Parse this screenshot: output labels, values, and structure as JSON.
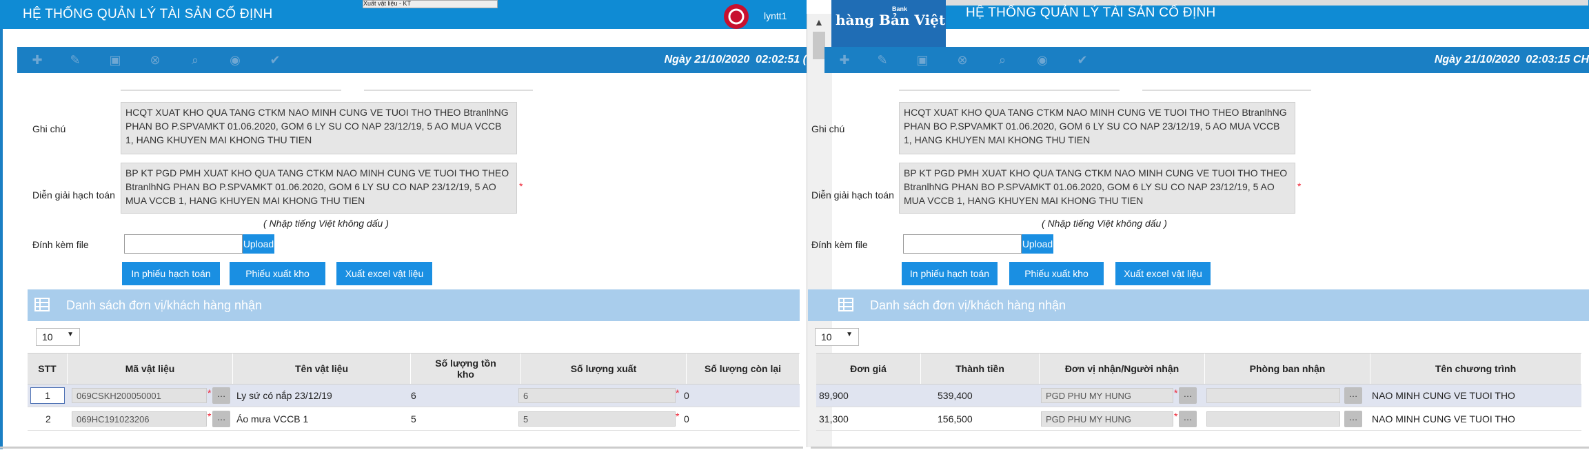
{
  "left": {
    "app_title": "HỆ THỐNG QUẢN LÝ TÀI SẢN CỐ ĐỊNH",
    "user": "lyntt1",
    "date_label": "Ngày",
    "date": "21/10/2020",
    "time": "02:02:51 (",
    "browser_tab": "Xuất vật liệu - KT"
  },
  "right": {
    "app_title": "HỆ THỐNG QUẢN LÝ TÀI SẢN CỐ ĐỊNH",
    "bank_logo_text": "hàng Bản Việt",
    "bank_logo_small": "Bank",
    "date_label": "Ngày",
    "date": "21/10/2020",
    "time": "02:03:15 CH"
  },
  "form": {
    "note_label": "Ghi chú",
    "note_value": "HCQT XUAT KHO QUA TANG CTKM NAO MINH CUNG VE TUOI THO THEO BtranlhNG PHAN BO P.SPVAMKT 01.06.2020, GOM 6 LY SU CO NAP 23/12/19, 5 AO MUA VCCB 1, HANG KHUYEN MAI KHONG THU TIEN",
    "explain_label": "Diễn giải hạch toán",
    "explain_value": "BP KT PGD PMH XUAT KHO QUA TANG CTKM NAO MINH CUNG VE TUOI THO THEO BtranlhNG PHAN BO P.SPVAMKT 01.06.2020, GOM 6 LY SU CO NAP 23/12/19, 5 AO MUA VCCB 1, HANG KHUYEN MAI KHONG THU TIEN",
    "hint": "( Nhập tiếng Việt không dấu )",
    "attach_label": "Đính kèm file",
    "upload_label": "Upload",
    "required_mark": "*"
  },
  "actions": {
    "print_accounting": "In phiếu hạch toán",
    "export_slip": "Phiếu xuất kho",
    "export_excel": "Xuất excel vật liệu"
  },
  "list_panel": {
    "title": "Danh sách đơn vị/khách hàng nhận",
    "page_size": "10"
  },
  "left_table": {
    "headers": [
      "STT",
      "Mã vật liệu",
      "Tên vật liệu",
      "Số lượng tồn kho",
      "Số lượng xuất",
      "Số lượng còn lại"
    ],
    "rows": [
      {
        "stt": "1",
        "code": "069CSKH200050001",
        "name": "Ly sứ có nắp 23/12/19",
        "stock": "6",
        "export": "6",
        "remain": "0"
      },
      {
        "stt": "2",
        "code": "069HC191023206",
        "name": "Áo mưa VCCB 1",
        "stock": "5",
        "export": "5",
        "remain": "0"
      }
    ]
  },
  "right_table": {
    "headers": [
      "Đơn giá",
      "Thành tiền",
      "Đơn vị nhận/Người nhận",
      "Phòng ban nhận",
      "Tên chương trình"
    ],
    "rows": [
      {
        "price": "89,900",
        "amount": "539,400",
        "receiver": "PGD PHU MY HUNG",
        "dept": "",
        "program": "NAO MINH CUNG VE TUOI THO"
      },
      {
        "price": "31,300",
        "amount": "156,500",
        "receiver": "PGD PHU MY HUNG",
        "dept": "",
        "program": "NAO MINH CUNG VE TUOI THO"
      }
    ]
  },
  "icons": {
    "toolbar": [
      "add-icon",
      "edit-icon",
      "save-icon",
      "delete-icon",
      "search-icon",
      "view-icon",
      "approve-icon"
    ],
    "more": "…"
  },
  "colors": {
    "header_blue": "#0f8bd4",
    "toolbar_blue": "#1a7fc4",
    "button_blue": "#1a8fe2",
    "panel_blue": "#a9cdec",
    "required_red": "#e23"
  }
}
